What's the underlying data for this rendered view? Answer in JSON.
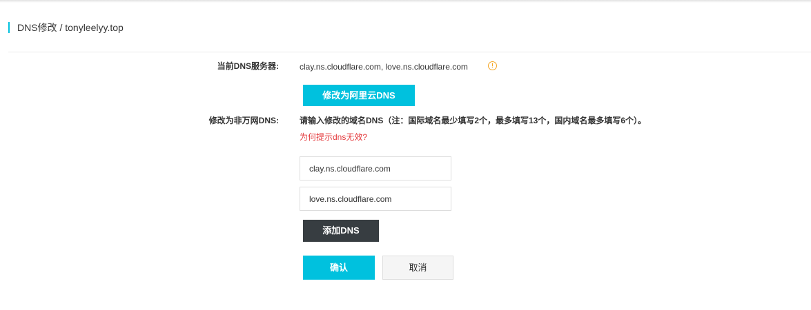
{
  "header": {
    "title": "DNS修改 / tonyleelyy.top"
  },
  "current_dns": {
    "label": "当前DNS服务器:",
    "value": "clay.ns.cloudflare.com, love.ns.cloudflare.com",
    "warning_icon": "info-circle-icon",
    "warning_color": "#f5a623"
  },
  "switch_aliyun": {
    "button_label": "修改为阿里云DNS"
  },
  "non_wan_dns": {
    "label": "修改为非万网DNS:",
    "instruction": "请输入修改的域名DNS（注：国际域名最少填写2个，最多填写13个，国内域名最多填写6个）。",
    "help_link": "为何提示dns无效?",
    "inputs": [
      {
        "value": "clay.ns.cloudflare.com"
      },
      {
        "value": "love.ns.cloudflare.com"
      }
    ],
    "add_button_label": "添加DNS"
  },
  "actions": {
    "confirm_label": "确认",
    "cancel_label": "取消"
  },
  "colors": {
    "accent": "#00c1de",
    "dark_button": "#373d41",
    "link_red": "#e4393c"
  }
}
